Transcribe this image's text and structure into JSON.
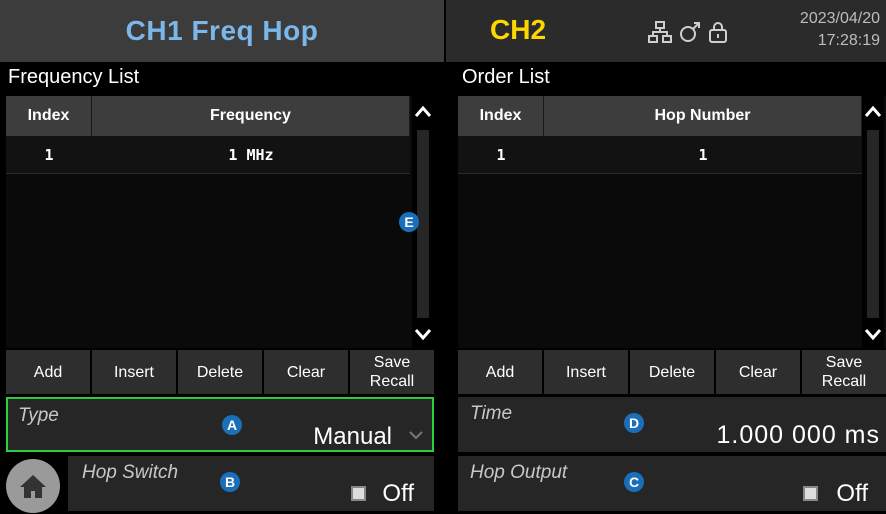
{
  "header": {
    "ch1_title": "CH1 Freq Hop",
    "ch2_title": "CH2",
    "date": "2023/04/20",
    "time": "17:28:19",
    "icons": [
      "network-icon",
      "usb-icon",
      "lock-icon"
    ]
  },
  "frequency_list": {
    "title": "Frequency List",
    "columns": [
      "Index",
      "Frequency"
    ],
    "rows": [
      [
        "1",
        "1 MHz"
      ]
    ]
  },
  "order_list": {
    "title": "Order List",
    "columns": [
      "Index",
      "Hop Number"
    ],
    "rows": [
      [
        "1",
        "1"
      ]
    ]
  },
  "freq_buttons": {
    "add": "Add",
    "insert": "Insert",
    "delete": "Delete",
    "clear": "Clear",
    "save": "Save",
    "recall": "Recall"
  },
  "order_buttons": {
    "add": "Add",
    "insert": "Insert",
    "delete": "Delete",
    "clear": "Clear",
    "save": "Save",
    "recall": "Recall"
  },
  "params": {
    "type": {
      "label": "Type",
      "value": "Manual",
      "badge": "A"
    },
    "hop_switch": {
      "label": "Hop Switch",
      "value": "Off",
      "badge": "B"
    },
    "time": {
      "label": "Time",
      "value": "1.000 000 ms",
      "badge": "D"
    },
    "hop_output": {
      "label": "Hop Output",
      "value": "Off",
      "badge": "C"
    }
  },
  "scroll_badge": "E",
  "colors": {
    "ch1": "#7cb7e8",
    "ch2": "#ffd700",
    "badge": "#1a6fb8",
    "focus_border": "#2ecc40"
  }
}
